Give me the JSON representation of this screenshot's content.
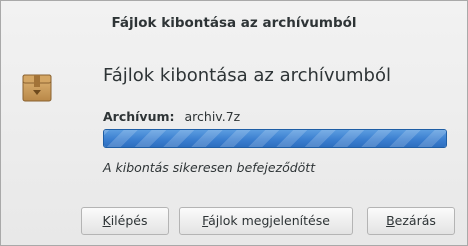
{
  "window": {
    "title": "Fájlok kibontása az archívumból"
  },
  "dialog": {
    "heading": "Fájlok kibontása az archívumból",
    "archive_label": "Archívum:",
    "archive_name": "archiv.7z",
    "progress_fraction": 1.0,
    "status": "A kibontás sikeresen befejeződött",
    "icon": "archive-box-icon"
  },
  "buttons": {
    "quit": {
      "mnemonic": "K",
      "rest": "ilépés"
    },
    "show": {
      "mnemonic": "F",
      "rest": "ájlok megjelenítése"
    },
    "close": {
      "mnemonic": "B",
      "rest": "ezárás"
    }
  },
  "colors": {
    "progress": "#3b7fd0",
    "text": "#2e3436"
  }
}
